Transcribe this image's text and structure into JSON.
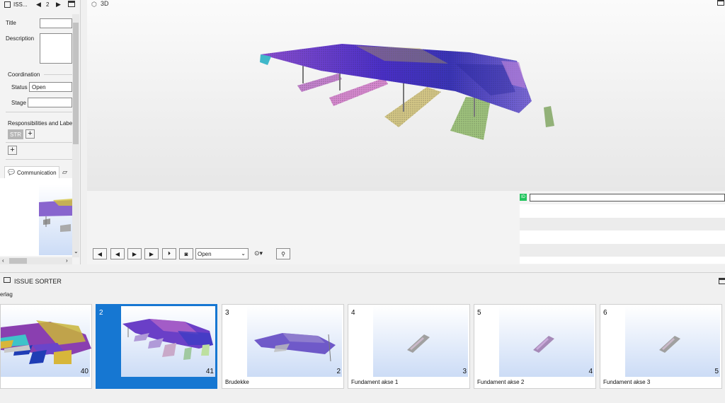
{
  "issue_panel": {
    "header_title": "ISS...",
    "issue_number": "2",
    "title_label": "Title",
    "title_value": "",
    "description_label": "Description",
    "description_value": "",
    "coordination_heading": "Coordination",
    "status_label": "Status",
    "status_value": "Open",
    "stage_label": "Stage",
    "stage_value": "",
    "responsibilities_heading": "Responsibilities and Labe",
    "str_tag": "STR",
    "communication_tab": "Communication"
  },
  "viewport": {
    "title": "3D"
  },
  "controls": {
    "status_select_value": "Open",
    "ifc_badge": "ID"
  },
  "sorter": {
    "title": "ISSUE SORTER",
    "group_label": "erlag",
    "cards": [
      {
        "number": "",
        "count": "40",
        "caption": ""
      },
      {
        "number": "2",
        "count": "41",
        "caption": ""
      },
      {
        "number": "3",
        "count": "2",
        "caption": "Brudekke"
      },
      {
        "number": "4",
        "count": "3",
        "caption": "Fundament akse 1"
      },
      {
        "number": "5",
        "count": "4",
        "caption": "Fundament akse 2"
      },
      {
        "number": "6",
        "count": "5",
        "caption": "Fundament akse 3"
      }
    ]
  },
  "colors": {
    "selection": "#1677d2",
    "badge_green": "#22c55e"
  }
}
